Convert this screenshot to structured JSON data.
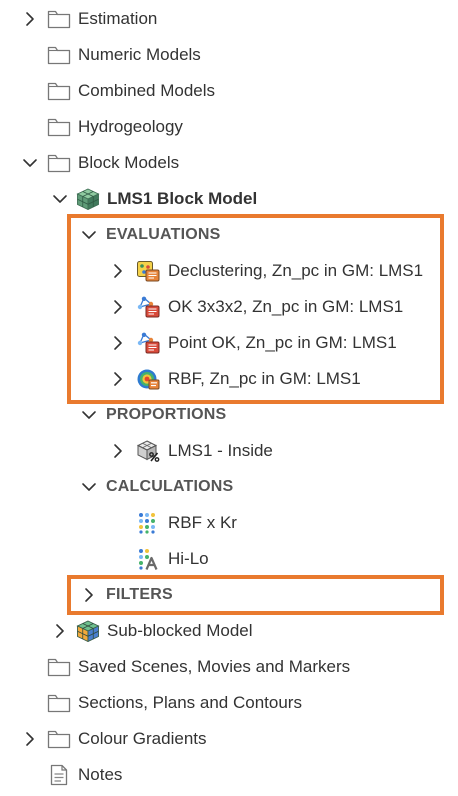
{
  "tree": {
    "estimation": "Estimation",
    "numeric_models": "Numeric Models",
    "combined_models": "Combined Models",
    "hydrogeology": "Hydrogeology",
    "block_models": "Block Models",
    "lms1_block_model": "LMS1 Block Model",
    "evaluations": "EVALUATIONS",
    "evaluation_items": [
      "Declustering, Zn_pc in GM: LMS1",
      "OK 3x3x2, Zn_pc in GM: LMS1",
      "Point OK, Zn_pc in GM: LMS1",
      "RBF, Zn_pc in GM: LMS1"
    ],
    "proportions": "PROPORTIONS",
    "proportion_items": [
      "LMS1 - Inside"
    ],
    "calculations": "CALCULATIONS",
    "calculation_items": [
      "RBF x Kr",
      "Hi-Lo"
    ],
    "filters": "FILTERS",
    "sub_blocked_model": "Sub-blocked Model",
    "saved_scenes": "Saved Scenes, Movies and Markers",
    "sections_plans": "Sections, Plans and Contours",
    "colour_gradients": "Colour Gradients",
    "notes": "Notes"
  },
  "colors": {
    "highlight": "#E97A2E",
    "text": "#333333",
    "section_text": "#555555",
    "chevron": "#333333"
  },
  "icons": {
    "folder": "folder-icon",
    "block_model": "block-model-icon",
    "evaluation": "evaluation-icon",
    "rbf_evaluation": "rbf-evaluation-icon",
    "proportion": "proportion-icon",
    "calculation": "calculation-icon",
    "category_calculation": "category-calculation-icon",
    "sub_blocked_model": "sub-blocked-model-icon",
    "notes": "notes-icon"
  }
}
